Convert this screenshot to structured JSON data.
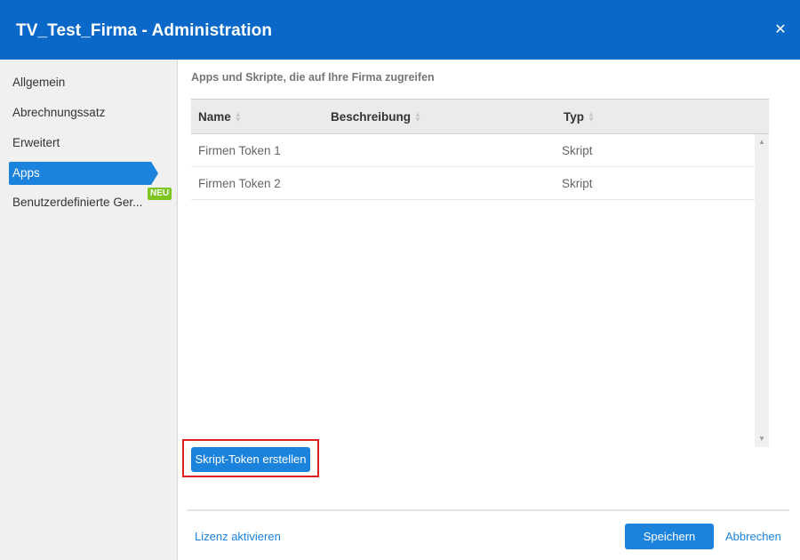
{
  "window": {
    "title": "TV_Test_Firma - Administration",
    "close_symbol": "✕"
  },
  "sidebar": {
    "items": [
      {
        "label": "Allgemein"
      },
      {
        "label": "Abrechnungssatz"
      },
      {
        "label": "Erweitert"
      },
      {
        "label": "Apps",
        "active": true
      },
      {
        "label": "Benutzerdefinierte Ger..."
      }
    ],
    "badge": "NEU"
  },
  "main": {
    "section_title": "Apps und Skripte, die auf Ihre Firma zugreifen",
    "table": {
      "columns": [
        "Name",
        "Beschreibung",
        "Typ"
      ],
      "rows": [
        {
          "name": "Firmen Token 1",
          "description": "",
          "type": "Skript"
        },
        {
          "name": "Firmen Token 2",
          "description": "",
          "type": "Skript"
        }
      ]
    },
    "create_token_button": "Skript-Token erstellen"
  },
  "footer": {
    "license_link": "Lizenz aktivieren",
    "save_button": "Speichern",
    "cancel_link": "Abbrechen"
  },
  "colors": {
    "titlebar": "#0a68c9",
    "accent": "#1b83db",
    "badge": "#7cc522",
    "highlight": "#e02020"
  },
  "icons": {
    "close": "close-icon",
    "sort": "sort-icon",
    "scroll_up": "chevron-up-icon",
    "scroll_down": "chevron-down-icon"
  }
}
